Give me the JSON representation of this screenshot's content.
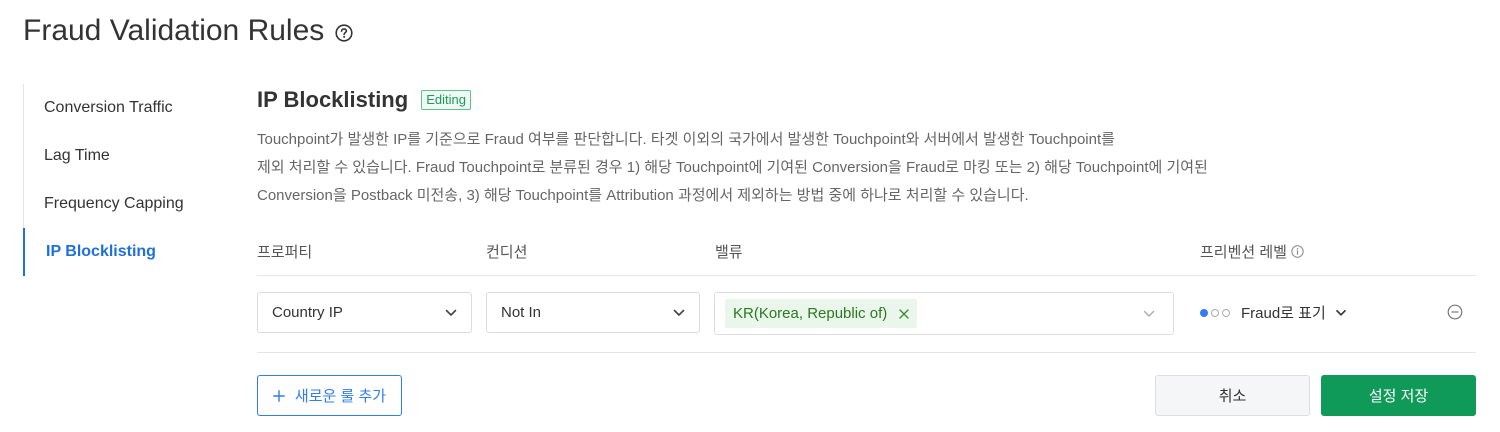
{
  "page": {
    "title": "Fraud Validation Rules"
  },
  "sidebar": {
    "items": [
      {
        "label": "Conversion Traffic"
      },
      {
        "label": "Lag Time"
      },
      {
        "label": "Frequency Capping"
      },
      {
        "label": "IP Blocklisting"
      }
    ],
    "active_index": 3
  },
  "section": {
    "title": "IP Blocklisting",
    "badge": "Editing",
    "description": [
      "Touchpoint가 발생한 IP를 기준으로 Fraud 여부를 판단합니다. 타겟 이외의 국가에서 발생한 Touchpoint와 서버에서 발생한 Touchpoint를",
      "제외 처리할 수 있습니다. Fraud Touchpoint로 분류된 경우 1) 해당 Touchpoint에 기여된 Conversion을 Fraud로 마킹 또는 2) 해당 Touchpoint에 기여된",
      "Conversion을 Postback 미전송, 3) 해당 Touchpoint를 Attribution 과정에서 제외하는 방법 중에 하나로 처리할 수 있습니다."
    ]
  },
  "table": {
    "headers": {
      "property": "프로퍼티",
      "condition": "컨디션",
      "value": "밸류",
      "prevention_level": "프리벤션 레벨"
    },
    "rows": [
      {
        "property": "Country IP",
        "condition": "Not In",
        "values": [
          "KR(Korea, Republic of)"
        ],
        "prevention_level": {
          "label": "Fraud로 표기",
          "level": 1,
          "max": 3
        }
      }
    ]
  },
  "buttons": {
    "add_rule": "새로운 룰 추가",
    "cancel": "취소",
    "save": "설정 저장"
  },
  "colors": {
    "accent_blue": "#2f7df0",
    "save_green": "#0f9a5a",
    "badge_green": "#1a9a5e",
    "tag_bg": "#eaf5ec",
    "tag_text": "#2a7a1f"
  },
  "icons": {
    "title_help": "question-circle-icon",
    "header_info": "info-circle-icon",
    "dropdown": "chevron-down-icon",
    "tag_remove": "close-icon",
    "row_remove": "minus-circle-icon",
    "add": "plus-icon"
  }
}
